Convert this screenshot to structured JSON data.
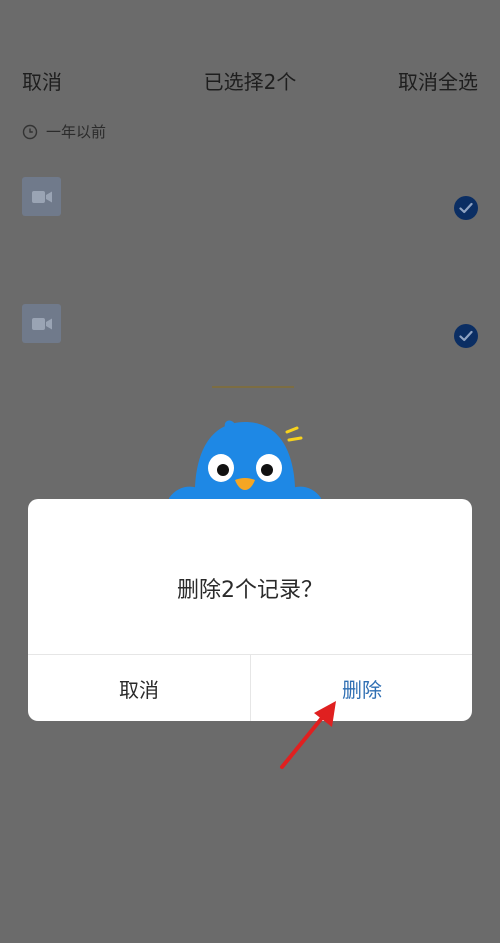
{
  "header": {
    "left_label": "取消",
    "title": "已选择2个",
    "right_label": "取消全选"
  },
  "section": {
    "label": "一年以前"
  },
  "items": [
    {
      "type": "video",
      "selected": true
    },
    {
      "type": "video",
      "selected": true
    }
  ],
  "dialog": {
    "message": "删除2个记录？",
    "cancel_label": "取消",
    "delete_label": "删除"
  },
  "colors": {
    "overlay": "#6b6b6b",
    "accent": "#2f6fb3",
    "check": "#0b2e63",
    "annotation_arrow": "#e02020"
  }
}
